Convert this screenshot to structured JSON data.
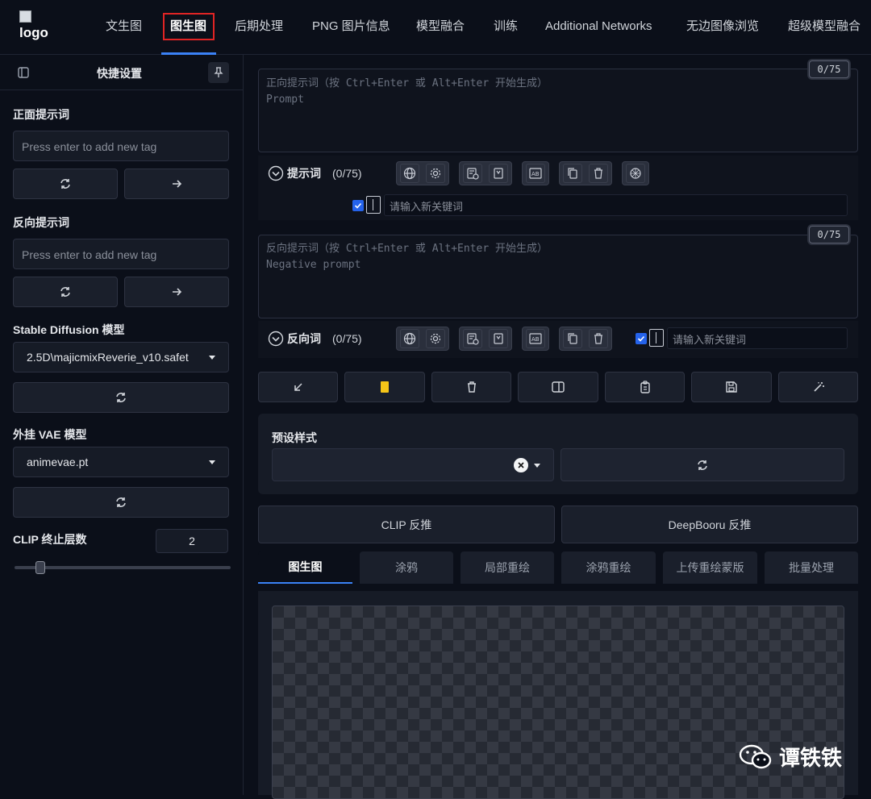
{
  "header": {
    "logo_alt": "logo",
    "tabs": [
      {
        "label": "文生图"
      },
      {
        "label": "图生图"
      },
      {
        "label": "后期处理"
      },
      {
        "label": "PNG 图片信息"
      },
      {
        "label": "模型融合"
      },
      {
        "label": "训练"
      },
      {
        "label": "Additional Networks"
      },
      {
        "label": "无边图像浏览"
      },
      {
        "label": "超级模型融合"
      }
    ],
    "active_tab": "图生图"
  },
  "sidebar": {
    "title": "快捷设置",
    "positive_label": "正面提示词",
    "positive_placeholder": "Press enter to add new tag",
    "negative_label": "反向提示词",
    "negative_placeholder": "Press enter to add new tag",
    "sd_model_label": "Stable Diffusion 模型",
    "sd_model_value": "2.5D\\majicmixReverie_v10.safet",
    "vae_label": "外挂 VAE 模型",
    "vae_value": "animevae.pt",
    "clip_label": "CLIP 终止层数",
    "clip_value": "2",
    "clip_slider_fraction": 0.1
  },
  "prompt": {
    "token_count": "0/75",
    "placeholder_line1": "正向提示词（按 Ctrl+Enter 或 Alt+Enter 开始生成）",
    "placeholder_line2": "Prompt",
    "toggle_label": "提示词",
    "toggle_count": "(0/75)",
    "keyword_placeholder": "请输入新关键词",
    "keyword_checked": true
  },
  "negative": {
    "token_count": "0/75",
    "placeholder_line1": "反向提示词（按 Ctrl+Enter 或 Alt+Enter 开始生成）",
    "placeholder_line2": "Negative prompt",
    "toggle_label": "反向词",
    "toggle_count": "(0/75)",
    "keyword_placeholder": "请输入新关键词",
    "keyword_checked": true
  },
  "styles": {
    "label": "预设样式"
  },
  "interrogate": {
    "clip_label": "CLIP 反推",
    "deepbooru_label": "DeepBooru 反推"
  },
  "subtabs": [
    {
      "label": "图生图"
    },
    {
      "label": "涂鸦"
    },
    {
      "label": "局部重绘"
    },
    {
      "label": "涂鸦重绘"
    },
    {
      "label": "上传重绘蒙版"
    },
    {
      "label": "批量处理"
    }
  ],
  "watermark": {
    "text": "谭铁铁"
  },
  "colors": {
    "accent": "#3b82f6",
    "active_tab_box": "#e02424",
    "yellow_swatch": "#f5c518",
    "background": "#0b0f19"
  }
}
